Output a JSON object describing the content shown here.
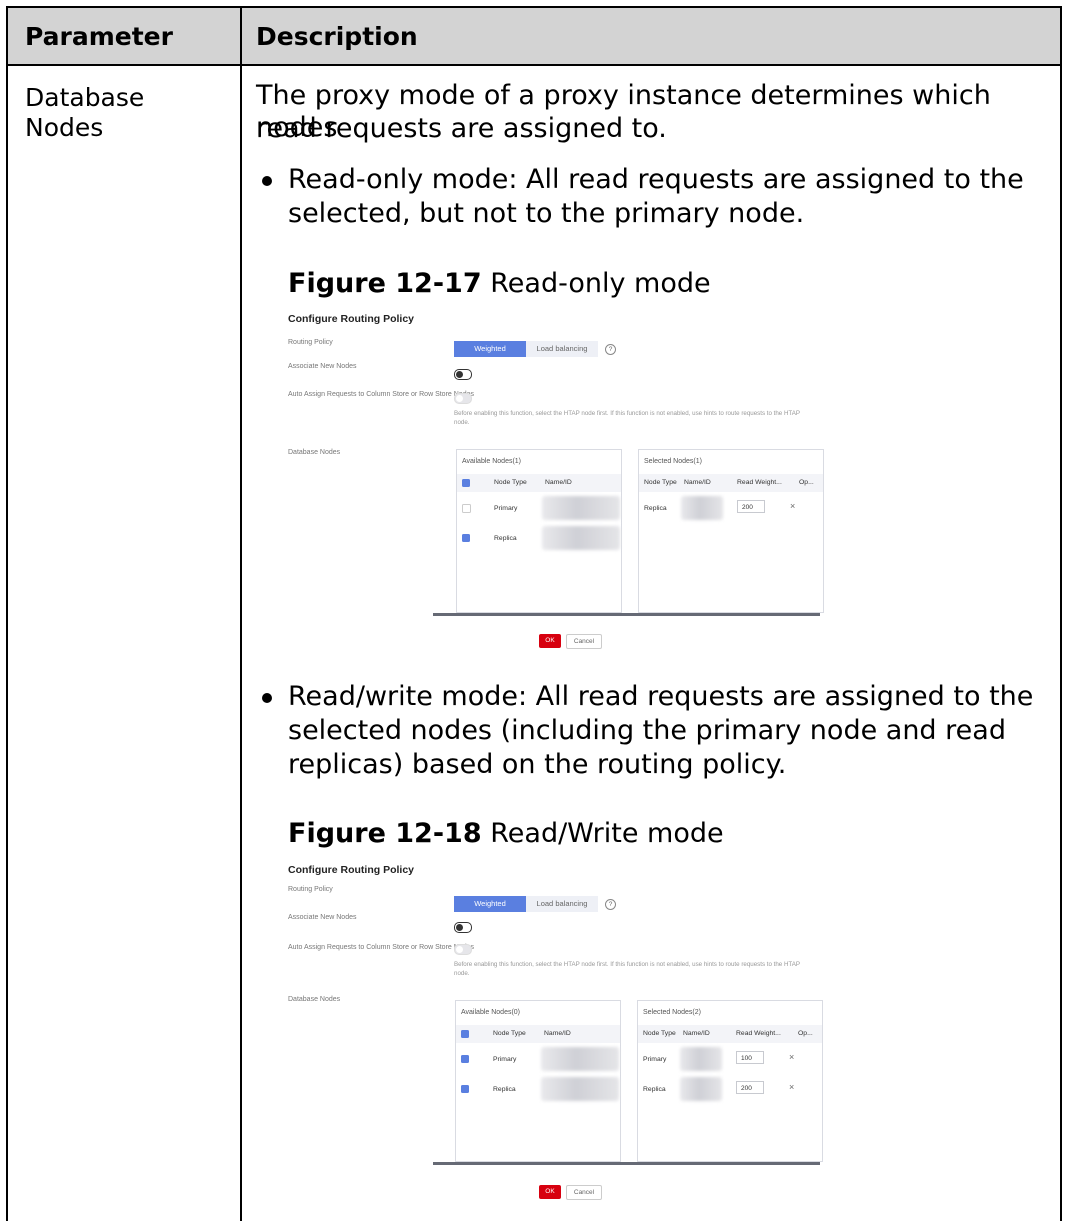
{
  "table": {
    "header": {
      "param": "Parameter",
      "desc": "Description"
    },
    "row": {
      "param_line1": "Database",
      "param_line2": "Nodes",
      "intro_line1": "The proxy mode of a proxy instance determines which nodes",
      "intro_line2": "read requests are assigned to.",
      "bullet1_line1": "Read-only mode: All read requests are assigned to the",
      "bullet1_line2": "selected, but not to the primary node.",
      "bullet2_line1": "Read/write mode: All read requests are assigned to the",
      "bullet2_line2": "selected nodes (including the primary node and read",
      "bullet2_line3": "replicas) based on the routing policy."
    }
  },
  "figures": [
    {
      "caption_label": "Figure 12-17",
      "caption_text": "Read-only mode",
      "title": "Configure Routing Policy",
      "routing_policy_label": "Routing Policy",
      "weighted_label": "Weighted",
      "load_balancing_label": "Load balancing",
      "help_glyph": "?",
      "associate_label": "Associate New Nodes",
      "auto_assign_label": "Auto Assign Requests to Column Store or Row Store Nodes",
      "hint_line1": "Before enabling this function, select the HTAP node first. If this function is not enabled, use hints to route requests to the HTAP",
      "hint_line2": "node.",
      "db_nodes_label": "Database Nodes",
      "available_title": "Available Nodes(1)",
      "selected_title": "Selected Nodes(1)",
      "col_node_type": "Node Type",
      "col_name_id": "Name/ID",
      "col_read_weight": "Read Weight...",
      "col_op": "Op...",
      "available_rows": [
        {
          "type": "Primary",
          "checked": false
        },
        {
          "type": "Replica",
          "checked": true
        }
      ],
      "selected_rows": [
        {
          "type": "Replica",
          "weight": "200"
        }
      ],
      "ok_label": "OK",
      "cancel_label": "Cancel"
    },
    {
      "caption_label": "Figure 12-18",
      "caption_text": "Read/Write mode",
      "title": "Configure Routing Policy",
      "routing_policy_label": "Routing Policy",
      "weighted_label": "Weighted",
      "load_balancing_label": "Load balancing",
      "help_glyph": "?",
      "associate_label": "Associate New Nodes",
      "auto_assign_label": "Auto Assign Requests to Column Store or Row Store Nodes",
      "hint_line1": "Before enabling this function, select the HTAP node first. If this function is not enabled, use hints to route requests to the HTAP",
      "hint_line2": "node.",
      "db_nodes_label": "Database Nodes",
      "available_title": "Available Nodes(0)",
      "selected_title": "Selected Nodes(2)",
      "col_node_type": "Node Type",
      "col_name_id": "Name/ID",
      "col_read_weight": "Read Weight...",
      "col_op": "Op...",
      "available_rows": [
        {
          "type": "Primary",
          "checked": true
        },
        {
          "type": "Replica",
          "checked": true
        }
      ],
      "selected_rows": [
        {
          "type": "Primary",
          "weight": "100"
        },
        {
          "type": "Replica",
          "weight": "200"
        }
      ],
      "ok_label": "OK",
      "cancel_label": "Cancel"
    }
  ],
  "colors": {
    "header_bg": "#d3d3d3",
    "accent": "#5a7fe0",
    "ok": "#d7000f"
  },
  "close_glyph": "×"
}
